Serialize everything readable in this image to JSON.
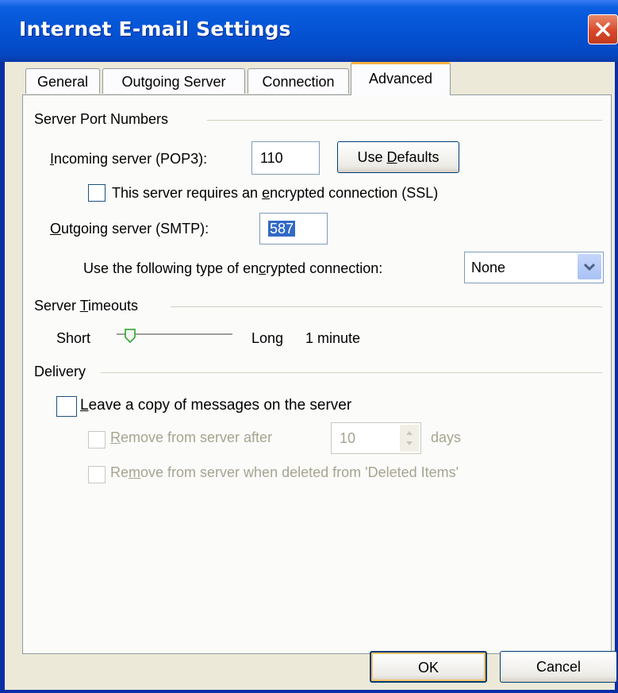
{
  "window": {
    "title": "Internet E-mail Settings"
  },
  "tabs": [
    {
      "label": "General",
      "active": false
    },
    {
      "label": "Outgoing Server",
      "active": false
    },
    {
      "label": "Connection",
      "active": false
    },
    {
      "label": "Advanced",
      "active": true
    }
  ],
  "server_ports": {
    "section_title": "Server Port Numbers",
    "incoming_label_pre": "I",
    "incoming_label_rest": "ncoming server (POP3):",
    "incoming_value": "110",
    "use_defaults_pre": "Use ",
    "use_defaults_u": "D",
    "use_defaults_rest": "efaults",
    "ssl_pre": "This server requires an ",
    "ssl_u": "e",
    "ssl_rest": "ncrypted connection (SSL)",
    "ssl_checked": false,
    "outgoing_label_pre": "O",
    "outgoing_label_rest": "utgoing server (SMTP):",
    "outgoing_value": "587",
    "encryption_pre": "Use the following type of en",
    "encryption_u": "c",
    "encryption_rest": "rypted connection:",
    "encryption_value": "None"
  },
  "timeouts": {
    "section_pre": "Server ",
    "section_u": "T",
    "section_rest": "imeouts",
    "short": "Short",
    "long": "Long",
    "value_text": "1 minute"
  },
  "delivery": {
    "section_title": "Delivery",
    "leave_copy_u": "L",
    "leave_copy_rest": "eave a copy of messages on the server",
    "leave_copy_checked": false,
    "remove_after_pre": "Remove from server after",
    "remove_after_u": "R",
    "remove_after_rest": "emove from server after",
    "remove_after_days": "10",
    "days": "days",
    "remove_deleted_pre": "Re",
    "remove_deleted_u": "m",
    "remove_deleted_rest": "ove from server when deleted from 'Deleted Items'"
  },
  "buttons": {
    "ok": "OK",
    "cancel": "Cancel"
  },
  "colors": {
    "title_bar": "#0453d4",
    "active_tab_accent": "#f9b341",
    "selection": "#316ac5"
  }
}
